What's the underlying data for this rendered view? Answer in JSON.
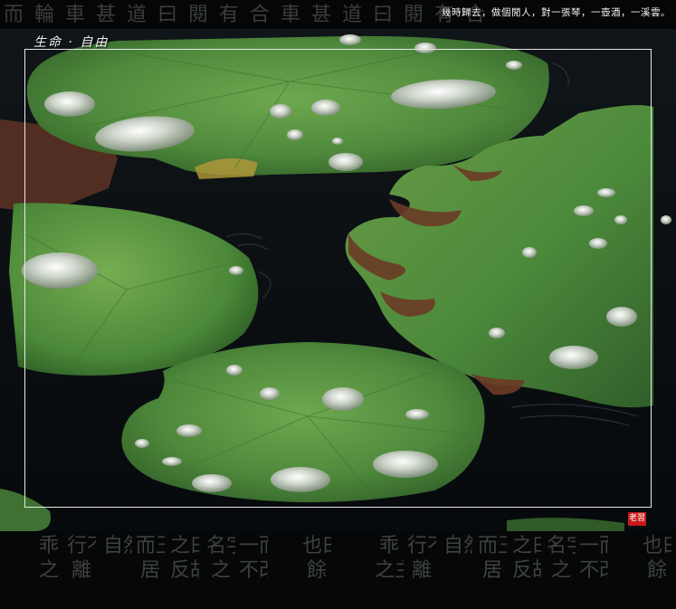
{
  "poster": {
    "title": "生命 · 自由",
    "poem": "幾時歸去，做個閒人，對一張琴，一壺酒，一溪雲。",
    "seal": "老習",
    "calligraphy_top": "而輪車甚道曰閱有合車甚道曰閱有合",
    "calligraphy_columns": [
      "乖\n之",
      "行不\n離",
      "自然",
      "而王\n居",
      "之曰\n反故",
      "名字\n之",
      "一而\n不改",
      "也曰\n餘",
      "乖\n之主",
      "行不\n離",
      "自然",
      "而王\n居",
      "之曰\n反故",
      "名字\n之",
      "一而\n不改",
      "也曰\n餘"
    ]
  },
  "colors": {
    "water": "#0d1114",
    "leaf_green": "#4f8a3c",
    "leaf_dark": "#2f5e27",
    "leaf_brown": "#6b3b26",
    "frame": "#e8e8e8",
    "seal": "#c8191c"
  }
}
